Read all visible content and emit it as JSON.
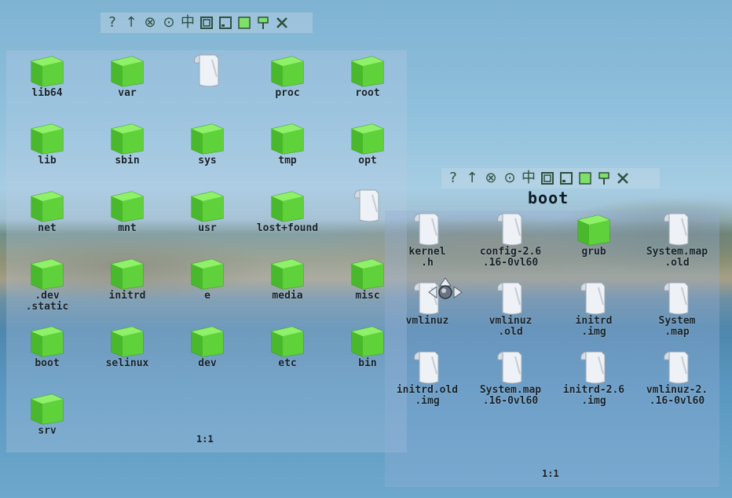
{
  "root_window": {
    "toolbar": [
      "help",
      "up",
      "close-all",
      "target",
      "split",
      "window-large",
      "window-small",
      "maximize",
      "pin",
      "tools"
    ],
    "items": [
      {
        "label": "lib64",
        "type": "folder"
      },
      {
        "label": "var",
        "type": "folder"
      },
      {
        "label": "",
        "type": "file"
      },
      {
        "label": "proc",
        "type": "folder"
      },
      {
        "label": "root",
        "type": "folder"
      },
      {
        "label": "lib",
        "type": "folder"
      },
      {
        "label": "sbin",
        "type": "folder"
      },
      {
        "label": "sys",
        "type": "folder"
      },
      {
        "label": "tmp",
        "type": "folder"
      },
      {
        "label": "opt",
        "type": "folder"
      },
      {
        "label": "net",
        "type": "folder"
      },
      {
        "label": "mnt",
        "type": "folder"
      },
      {
        "label": "usr",
        "type": "folder"
      },
      {
        "label": "lost+found",
        "type": "folder"
      },
      {
        "label": "",
        "type": "file"
      },
      {
        "label": ".dev\n.static",
        "type": "folder"
      },
      {
        "label": "initrd",
        "type": "folder"
      },
      {
        "label": "e",
        "type": "folder"
      },
      {
        "label": "media",
        "type": "folder"
      },
      {
        "label": "misc",
        "type": "folder"
      },
      {
        "label": "boot",
        "type": "folder"
      },
      {
        "label": "selinux",
        "type": "folder"
      },
      {
        "label": "dev",
        "type": "folder"
      },
      {
        "label": "etc",
        "type": "folder"
      },
      {
        "label": "bin",
        "type": "folder"
      },
      {
        "label": "srv",
        "type": "folder"
      }
    ],
    "scale": "1:1"
  },
  "boot_window": {
    "title": "boot",
    "toolbar": [
      "help",
      "up",
      "close-all",
      "target",
      "split",
      "window-large",
      "window-small",
      "maximize",
      "pin",
      "tools"
    ],
    "items": [
      {
        "label": "kernel\n.h",
        "type": "file"
      },
      {
        "label": "config-2.6\n.16-0vl60",
        "type": "file"
      },
      {
        "label": "grub",
        "type": "folder"
      },
      {
        "label": "System.map\n.old",
        "type": "file"
      },
      {
        "label": "vmlinuz",
        "type": "file"
      },
      {
        "label": "vmlinuz\n.old",
        "type": "file"
      },
      {
        "label": "initrd\n.img",
        "type": "file"
      },
      {
        "label": "System\n.map",
        "type": "file"
      },
      {
        "label": "initrd.old\n.img",
        "type": "file"
      },
      {
        "label": "System.map\n.16-0vl60",
        "type": "file"
      },
      {
        "label": "initrd-2.6\n.img",
        "type": "file"
      },
      {
        "label": "vmlinuz-2.\n.16-0vl60",
        "type": "file"
      }
    ],
    "scale": "1:1"
  },
  "colors": {
    "folder_green": "#5fd13a",
    "file_white": "#eef1f5"
  }
}
